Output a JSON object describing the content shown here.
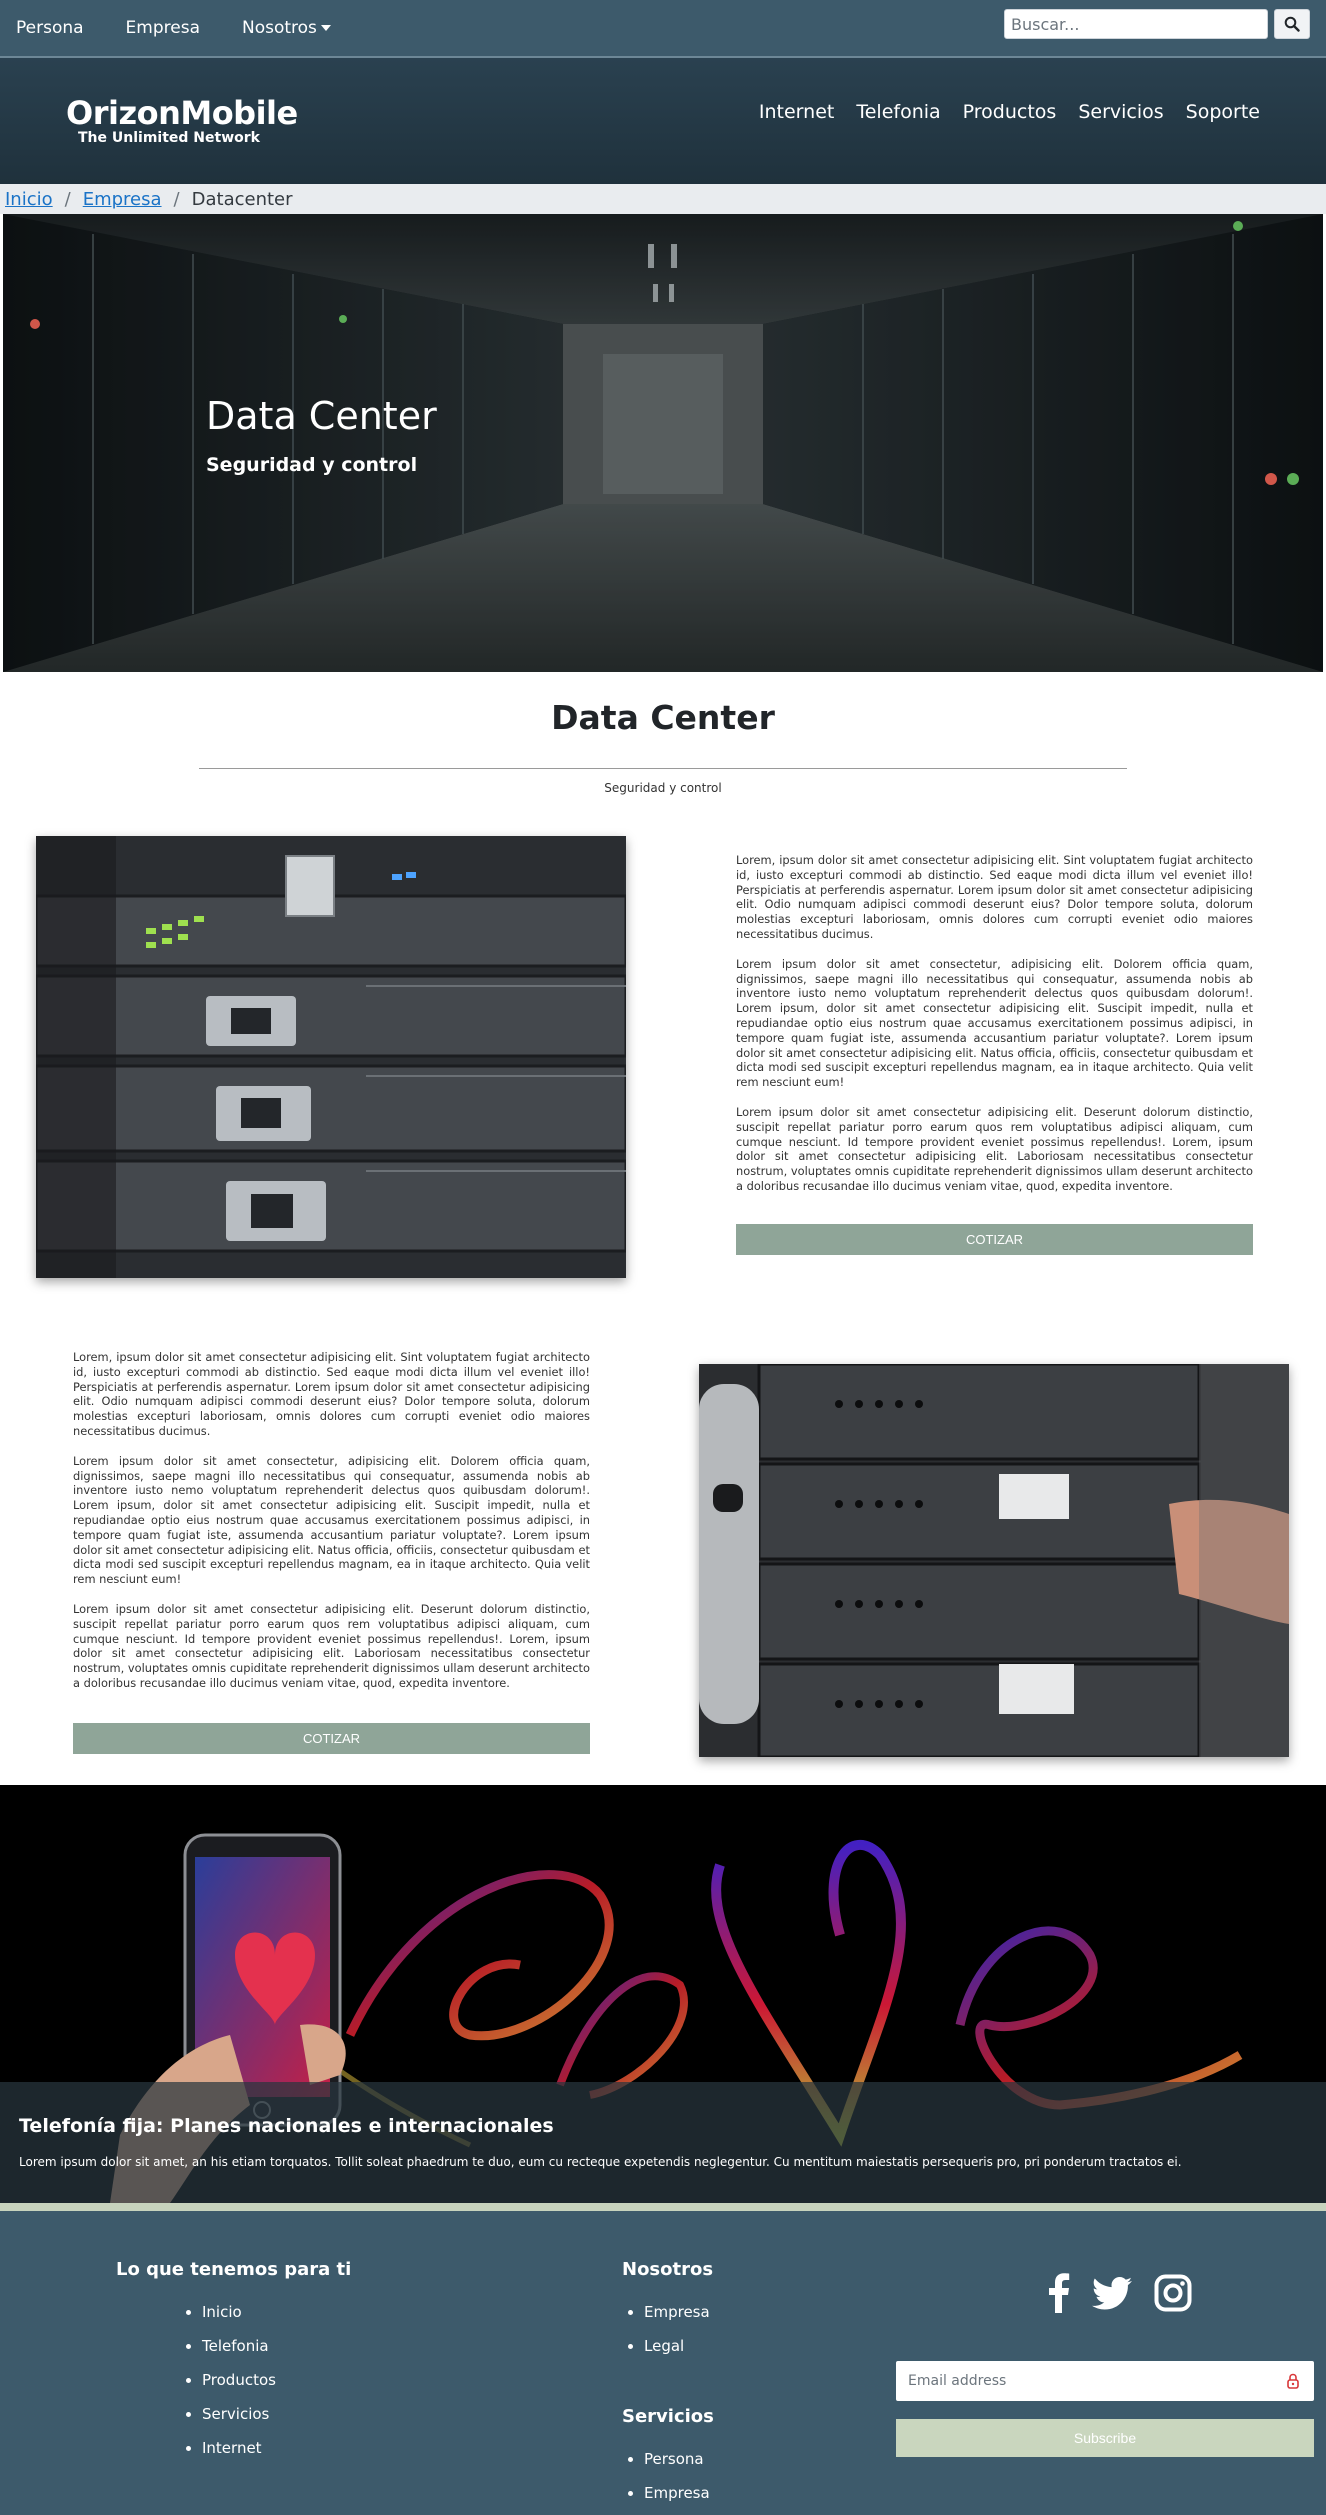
{
  "topbar": {
    "links": [
      "Persona",
      "Empresa",
      "Nosotros"
    ],
    "search_placeholder": "Buscar..."
  },
  "header": {
    "brand": "OrizonMobile",
    "tagline": "The Unlimited Network",
    "nav": [
      "Internet",
      "Telefonia",
      "Productos",
      "Servicios",
      "Soporte"
    ]
  },
  "breadcrumb": {
    "items": [
      "Inicio",
      "Empresa ",
      "Datacenter"
    ]
  },
  "hero": {
    "title": "Data Center",
    "subtitle": "Seguridad y control"
  },
  "section": {
    "title": "Data Center",
    "subtitle": "Seguridad y control"
  },
  "feature": {
    "paragraphs": [
      "Lorem, ipsum dolor sit amet consectetur adipisicing elit. Sint voluptatem fugiat architecto id, iusto excepturi commodi ab distinctio. Sed eaque modi dicta illum vel eveniet illo! Perspiciatis at perferendis aspernatur. Lorem ipsum dolor sit amet consectetur adipisicing elit. Odio numquam adipisci commodi deserunt eius? Dolor tempore soluta, dolorum molestias excepturi laboriosam, omnis dolores cum corrupti eveniet odio maiores necessitatibus ducimus.",
      "Lorem ipsum dolor sit amet consectetur, adipisicing elit. Dolorem officia quam, dignissimos, saepe magni illo necessitatibus qui consequatur, assumenda nobis ab inventore iusto nemo voluptatum reprehenderit delectus quos quibusdam dolorum!. Lorem ipsum, dolor sit amet consectetur adipisicing elit. Suscipit impedit, nulla et repudiandae optio eius nostrum quae accusamus exercitationem possimus adipisci, in tempore quam fugiat iste, assumenda accusantium pariatur voluptate?. Lorem ipsum dolor sit amet consectetur adipisicing elit. Natus officia, officiis, consectetur quibusdam et dicta modi sed suscipit excepturi repellendus magnam, ea in itaque architecto. Quia velit rem nesciunt eum!",
      "Lorem ipsum dolor sit amet consectetur adipisicing elit. Deserunt dolorum distinctio, suscipit repellat pariatur porro earum quos rem voluptatibus adipisci aliquam, cum cumque nesciunt. Id tempore provident eveniet possimus repellendus!. Lorem, ipsum dolor sit amet consectetur adipisicing elit. Laboriosam necessitatibus consectetur nostrum, voluptates omnis cupiditate reprehenderit dignissimos ullam deserunt architecto a doloribus recusandae illo ducimus veniam vitae, quod, expedita inventore."
    ],
    "cta": "COTIZAR"
  },
  "promo": {
    "title": "Telefonía fija: Planes nacionales e internacionales",
    "text": "Lorem ipsum dolor sit amet, an his etiam torquatos. Tollit soleat phaedrum te duo, eum cu recteque expetendis neglegentur. Cu mentitum maiestatis persequeris pro, pri ponderum tractatos ei."
  },
  "footer": {
    "col1_title": "Lo que tenemos para ti",
    "col1_items": [
      "Inicio",
      "Telefonia",
      "Productos",
      "Servicios",
      "Internet"
    ],
    "col2_title": "Nosotros",
    "col2_items": [
      "Empresa",
      "Legal"
    ],
    "col3_title": "Servicios",
    "col3_items": [
      "Persona",
      "Empresa"
    ],
    "social_icons": [
      "facebook-icon",
      "twitter-icon",
      "instagram-icon"
    ],
    "email_placeholder": "Email address",
    "subscribe": "Subscribe"
  },
  "colors": {
    "topbar": "#3d5a6b",
    "header": "#1f313c",
    "cta": "#8fa598",
    "footer": "#3d5a6b",
    "subscribe": "#c9d6be"
  }
}
